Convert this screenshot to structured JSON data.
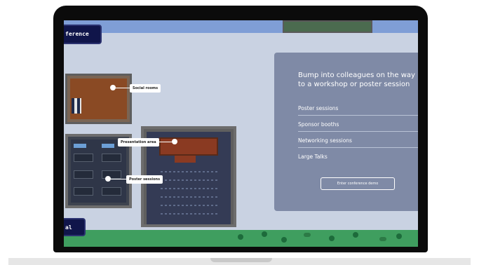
{
  "brand": {
    "top_label": "ference",
    "bottom_label": "al"
  },
  "room_labels": {
    "social_rooms": "Social rooms",
    "presentation_area": "Presentation area",
    "poster_sessions": "Poster sessions"
  },
  "info_panel": {
    "heading": "Bump into colleagues on the way to a workshop or poster session",
    "items": [
      {
        "label": "Poster sessions"
      },
      {
        "label": "Sponsor booths"
      },
      {
        "label": "Networking sessions"
      },
      {
        "label": "Large Talks"
      }
    ],
    "cta_label": "Enter conference demo"
  },
  "colors": {
    "panel_bg": "#7f8aa6",
    "map_bg": "#c9d2e2",
    "brand_tag": "#10154a",
    "grass": "#3f9e5f"
  }
}
